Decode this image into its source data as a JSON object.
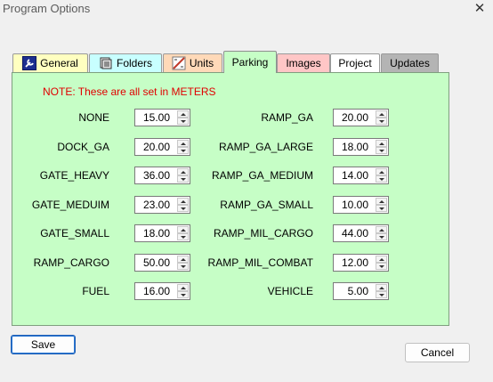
{
  "window": {
    "title": "Program Options",
    "close_glyph": "✕"
  },
  "tabs": [
    {
      "label": "General",
      "icon": "wrench-icon",
      "color": "#ffffc0"
    },
    {
      "label": "Folders",
      "icon": "folder-icon",
      "color": "#c8ffff"
    },
    {
      "label": "Units",
      "icon": "ruler-icon",
      "color": "#ffd9b8"
    },
    {
      "label": "Parking",
      "icon": "",
      "color": "#c6fec6",
      "active": true
    },
    {
      "label": "Images",
      "icon": "",
      "color": "#ffc6c6"
    },
    {
      "label": "Project",
      "icon": "",
      "color": "#ffffff"
    },
    {
      "label": "Updates",
      "icon": "",
      "color": "#b4b4b4"
    }
  ],
  "parking": {
    "note": "NOTE: These are all set in METERS",
    "left_fields": [
      {
        "label": "NONE",
        "value": "15.00"
      },
      {
        "label": "DOCK_GA",
        "value": "20.00"
      },
      {
        "label": "GATE_HEAVY",
        "value": "36.00"
      },
      {
        "label": "GATE_MEDUIM",
        "value": "23.00"
      },
      {
        "label": "GATE_SMALL",
        "value": "18.00"
      },
      {
        "label": "RAMP_CARGO",
        "value": "50.00"
      },
      {
        "label": "FUEL",
        "value": "16.00"
      }
    ],
    "right_fields": [
      {
        "label": "RAMP_GA",
        "value": "20.00"
      },
      {
        "label": "RAMP_GA_LARGE",
        "value": "18.00"
      },
      {
        "label": "RAMP_GA_MEDIUM",
        "value": "14.00"
      },
      {
        "label": "RAMP_GA_SMALL",
        "value": "10.00"
      },
      {
        "label": "RAMP_MIL_CARGO",
        "value": "44.00"
      },
      {
        "label": "RAMP_MIL_COMBAT",
        "value": "12.00"
      },
      {
        "label": "VEHICLE",
        "value": "5.00"
      }
    ]
  },
  "buttons": {
    "save": "Save",
    "cancel": "Cancel"
  },
  "colors": {
    "panel_bg": "#c6fec6",
    "note_text": "#e00000",
    "default_button_border": "#1f5fb5"
  }
}
